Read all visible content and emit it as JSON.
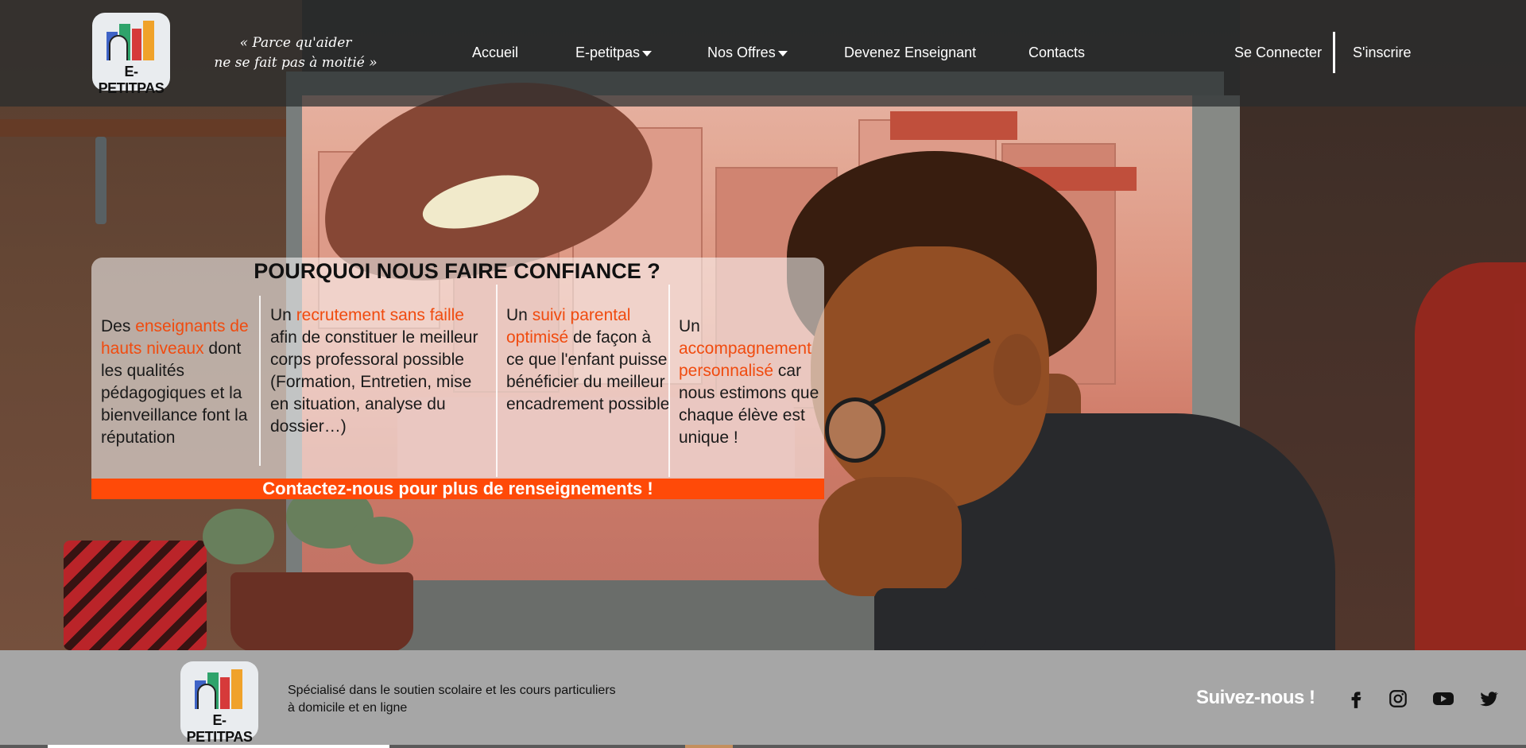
{
  "brand": {
    "logo_text": "E-PETITPAS",
    "tagline_line1": "« Parce qu'aider",
    "tagline_line2": "ne se fait pas à moitié »",
    "colors": {
      "accent": "#ff4a08",
      "highlight": "#f04b0f",
      "header_bg": "#282c2e",
      "footer_bg": "#a6a6a6"
    }
  },
  "nav": {
    "accueil": "Accueil",
    "epetitpas": "E-petitpas",
    "offres": "Nos Offres",
    "enseignant": "Devenez Enseignant",
    "contacts": "Contacts",
    "login": "Se Connecter",
    "signup": "S'inscrire"
  },
  "trust": {
    "title": "POURQUOI NOUS FAIRE CONFIANCE ?",
    "col1": {
      "pre": "Des ",
      "hl": "enseignants de hauts niveaux",
      "post": " dont les qualités pédagogiques et la bienveillance font la réputation"
    },
    "col2": {
      "pre": "Un ",
      "hl": "recrutement sans faille",
      "post": " afin de constituer le meilleur corps professoral possible (Formation, Entretien, mise en situation, analyse du dossier…)"
    },
    "col3": {
      "pre": "Un ",
      "hl": "suivi parental optimisé",
      "post": " de façon à ce que l'enfant puisse bénéficier du meilleur encadrement possible"
    },
    "col4": {
      "pre": "Un ",
      "hl": "accompagnement personnalisé",
      "post": " car nous estimons que chaque élève est unique !"
    },
    "cta": "Contactez-nous pour plus de renseignements !"
  },
  "footer": {
    "logo_text": "E-PETITPAS",
    "description": "Spécialisé dans le soutien scolaire et les cours particuliers à domicile et en ligne",
    "follow": "Suivez-nous !",
    "social": [
      "facebook-icon",
      "instagram-icon",
      "youtube-icon",
      "twitter-icon"
    ]
  }
}
